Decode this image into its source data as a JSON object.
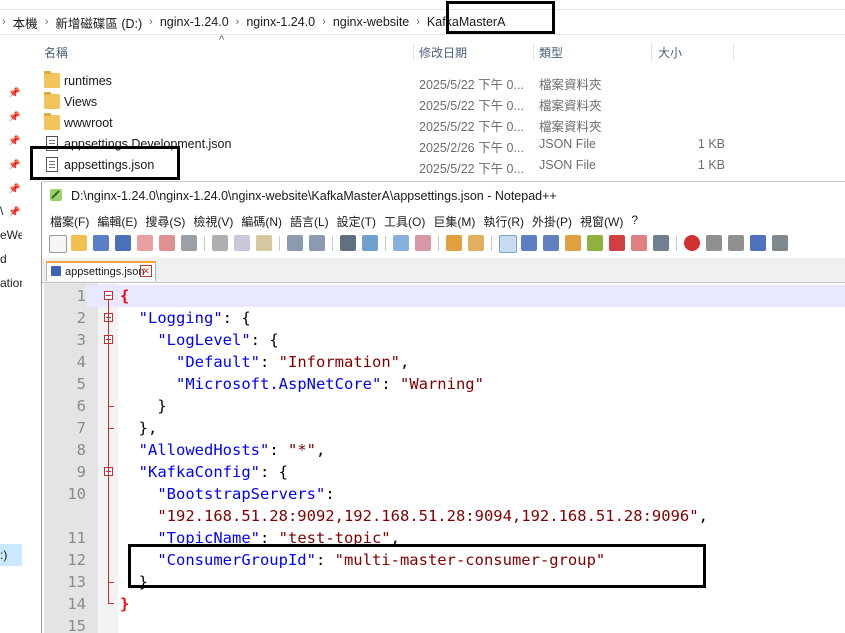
{
  "explorer": {
    "breadcrumbs": [
      "本機",
      "新增磁碟區 (D:)",
      "nginx-1.24.0",
      "nginx-1.24.0",
      "nginx-website",
      "KafkaMasterA"
    ],
    "columns": {
      "name": "名稱",
      "date": "修改日期",
      "type": "類型",
      "size": "大小"
    },
    "files": [
      {
        "name": "runtimes",
        "date": "2025/5/22 下午 0...",
        "type": "檔案資料夾",
        "size": "",
        "icon": "folder-icon"
      },
      {
        "name": "Views",
        "date": "2025/5/22 下午 0...",
        "type": "檔案資料夾",
        "size": "",
        "icon": "folder-icon"
      },
      {
        "name": "wwwroot",
        "date": "2025/5/22 下午 0...",
        "type": "檔案資料夾",
        "size": "",
        "icon": "folder-icon"
      },
      {
        "name": "appsettings.Development.json",
        "date": "2025/2/26 下午 0...",
        "type": "JSON File",
        "size": "1 KB",
        "icon": "json-file-icon"
      },
      {
        "name": "appsettings.json",
        "date": "2025/5/22 下午 0...",
        "type": "JSON File",
        "size": "1 KB",
        "icon": "json-file-icon"
      }
    ],
    "nav_fragments": [
      "\\",
      "eWe",
      "d",
      "ation",
      ":)"
    ]
  },
  "notepad": {
    "title": "D:\\nginx-1.24.0\\nginx-1.24.0\\nginx-website\\KafkaMasterA\\appsettings.json - Notepad++",
    "menu": [
      "檔案(F)",
      "編輯(E)",
      "搜尋(S)",
      "檢視(V)",
      "編碼(N)",
      "語言(L)",
      "設定(T)",
      "工具(O)",
      "巨集(M)",
      "執行(R)",
      "外掛(P)",
      "視窗(W)",
      "?"
    ],
    "tab_label": "appsettings.json",
    "line_numbers": [
      "1",
      "2",
      "3",
      "4",
      "5",
      "6",
      "7",
      "8",
      "9",
      "10",
      "",
      "11",
      "12",
      "13",
      "14",
      "15"
    ],
    "code": {
      "brace_open": "{",
      "logging_key": "\"Logging\"",
      "loglevel_key": "\"LogLevel\"",
      "default_key": "\"Default\"",
      "default_val": "\"Information\"",
      "aspnet_key": "\"Microsoft.AspNetCore\"",
      "aspnet_val": "\"Warning\"",
      "allowed_key": "\"AllowedHosts\"",
      "allowed_val": "\"*\"",
      "kafka_key": "\"KafkaConfig\"",
      "bootstrap_key": "\"BootstrapServers\"",
      "bootstrap_val": "\"192.168.51.28:9092,192.168.51.28:9094,192.168.51.28:9096\"",
      "topic_key": "\"TopicName\"",
      "topic_val": "\"test-topic\"",
      "group_key": "\"ConsumerGroupId\"",
      "group_val": "\"multi-master-consumer-group\"",
      "brace_close": "}"
    }
  },
  "colors": {
    "key": "#0000ff",
    "value": "#800000",
    "brace": "#ff0000",
    "current_line": "#e8e8ff",
    "selection": "#cce8ff"
  }
}
